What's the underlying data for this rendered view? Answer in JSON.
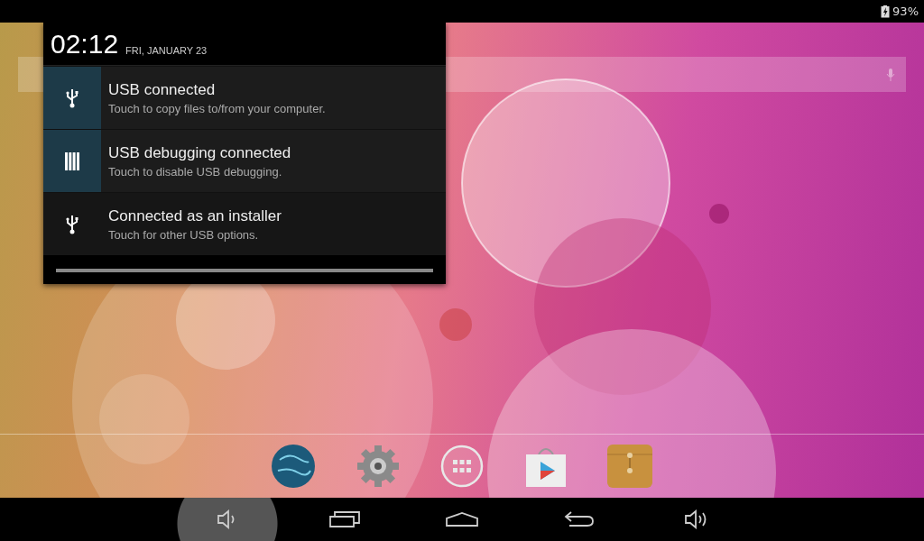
{
  "status_bar": {
    "battery": "93%"
  },
  "notification_panel": {
    "time": "02:12",
    "date": "FRI, JANUARY 23",
    "notifications": [
      {
        "kind": "usb",
        "highlighted": true,
        "title": "USB connected",
        "text": "Touch to copy files to/from your computer."
      },
      {
        "kind": "debug",
        "highlighted": true,
        "title": "USB debugging connected",
        "text": "Touch to disable USB debugging."
      },
      {
        "kind": "usb",
        "highlighted": false,
        "title": "Connected as an installer",
        "text": "Touch for other USB options."
      }
    ]
  },
  "dock": [
    {
      "kind": "browser"
    },
    {
      "kind": "settings"
    },
    {
      "kind": "apps"
    },
    {
      "kind": "store"
    },
    {
      "kind": "files"
    }
  ],
  "nav_bar": [
    {
      "kind": "volume-down",
      "pressed": true
    },
    {
      "kind": "recent",
      "pressed": false
    },
    {
      "kind": "home",
      "pressed": false
    },
    {
      "kind": "back",
      "pressed": false
    },
    {
      "kind": "volume-up",
      "pressed": false
    }
  ]
}
